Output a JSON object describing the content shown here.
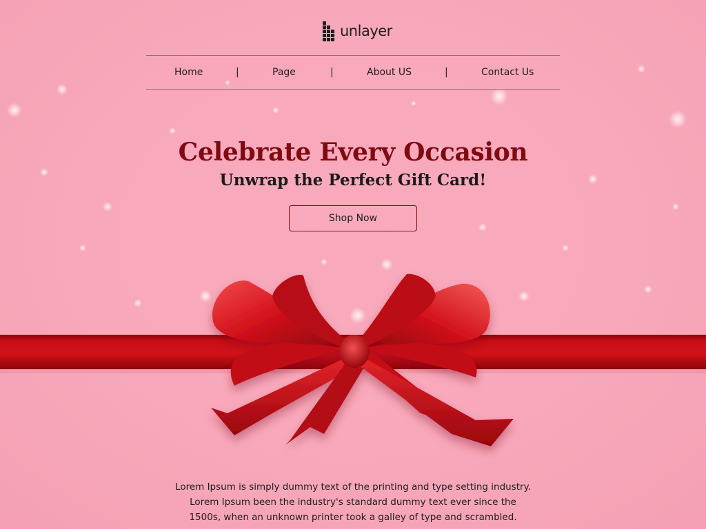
{
  "brand": {
    "logo_text": "unlayer",
    "logo_icon": "unlayer-logo-icon"
  },
  "nav": {
    "items": [
      {
        "label": "Home"
      },
      {
        "label": "Page"
      },
      {
        "label": "About US"
      },
      {
        "label": "Contact Us"
      }
    ],
    "separator": "|"
  },
  "hero": {
    "title": "Celebrate Every Occasion",
    "subtitle": "Unwrap the Perfect Gift Card!",
    "cta_label": "Shop Now",
    "image": "red-ribbon-bow"
  },
  "body": {
    "lines": [
      "Lorem Ipsum is simply dummy text of the printing and type setting industry.",
      "Lorem Ipsum been the industry's standard dummy text ever since the",
      "1500s, when an unknown printer took a galley of type and scrambled."
    ]
  },
  "colors": {
    "background": "#f8a9bb",
    "title": "#7f0a12",
    "ribbon": "#c10a14",
    "text": "#1e1e1e"
  }
}
